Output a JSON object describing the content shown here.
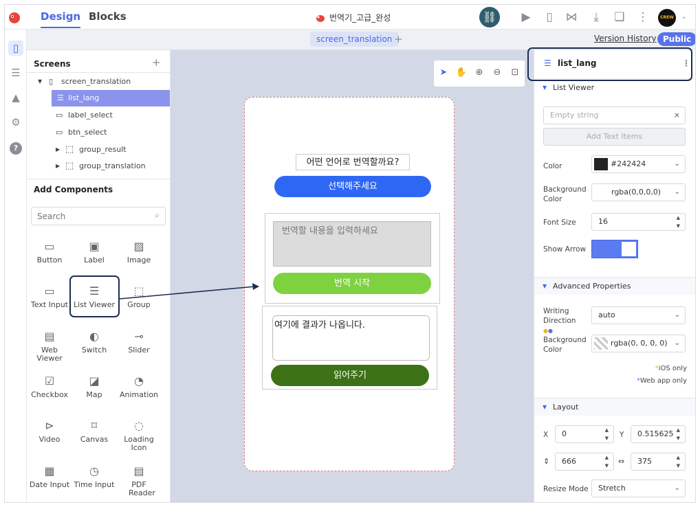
{
  "topbar": {
    "tabs": [
      "Design",
      "Blocks"
    ],
    "app_title": "번역기_고급_완성",
    "avatar_text": "CREW"
  },
  "subbar": {
    "screen_tab": "screen_translation",
    "add_tab": "+",
    "version_history": "Version History",
    "public_badge": "Public"
  },
  "screens": {
    "title": "Screens",
    "add": "+",
    "items": [
      "screen_translation",
      "list_lang",
      "label_select",
      "btn_select",
      "group_result",
      "group_translation"
    ]
  },
  "components": {
    "title": "Add Components",
    "search_placeholder": "Search",
    "items": [
      "Button",
      "Label",
      "Image",
      "Text Input",
      "List Viewer",
      "Group",
      "Web Viewer",
      "Switch",
      "Slider",
      "Checkbox",
      "Map",
      "Animation",
      "Video",
      "Canvas",
      "Loading Icon",
      "Date Input",
      "Time Input",
      "PDF Reader"
    ]
  },
  "phone": {
    "question_label": "어떤 언어로 번역할까요?",
    "select_button": "선택해주세요",
    "input_placeholder": "번역할 내용을 입력하세요",
    "translate_button": "번역 시작",
    "result_text": "여기에 결과가 나옵니다.",
    "read_button": "읽어주기"
  },
  "properties": {
    "selected": "list_lang",
    "list_viewer_section": "List Viewer",
    "empty_placeholder": "Empty string",
    "add_text_items": "Add Text Items",
    "color_label": "Color",
    "color_value": "#242424",
    "bg_color_label": "Background Color",
    "bg_color_value": "rgba(0,0,0,0)",
    "font_size_label": "Font Size",
    "font_size_value": "16",
    "show_arrow_label": "Show Arrow",
    "advanced_section": "Advanced Properties",
    "writing_direction_label": "Writing Direction",
    "writing_direction_value": "auto",
    "bg_color2_label": "Background Color",
    "bg_color2_value": "rgba(0, 0, 0, 0)",
    "ios_only": "iOS only",
    "web_only": "Web app only",
    "layout_section": "Layout",
    "x_label": "X",
    "x_value": "0",
    "y_label": "Y",
    "y_value": "0.515625",
    "height_value": "666",
    "width_value": "375",
    "resize_label": "Resize Mode",
    "resize_value": "Stretch"
  },
  "colors": {
    "accent": "#4a67e8",
    "selected_tree": "#8b93ec",
    "select_button": "#2d67f4",
    "translate_button": "#7ed23f",
    "read_button": "#3d7116",
    "toggle": "#5a7cf0",
    "callout": "#1b2b52"
  }
}
